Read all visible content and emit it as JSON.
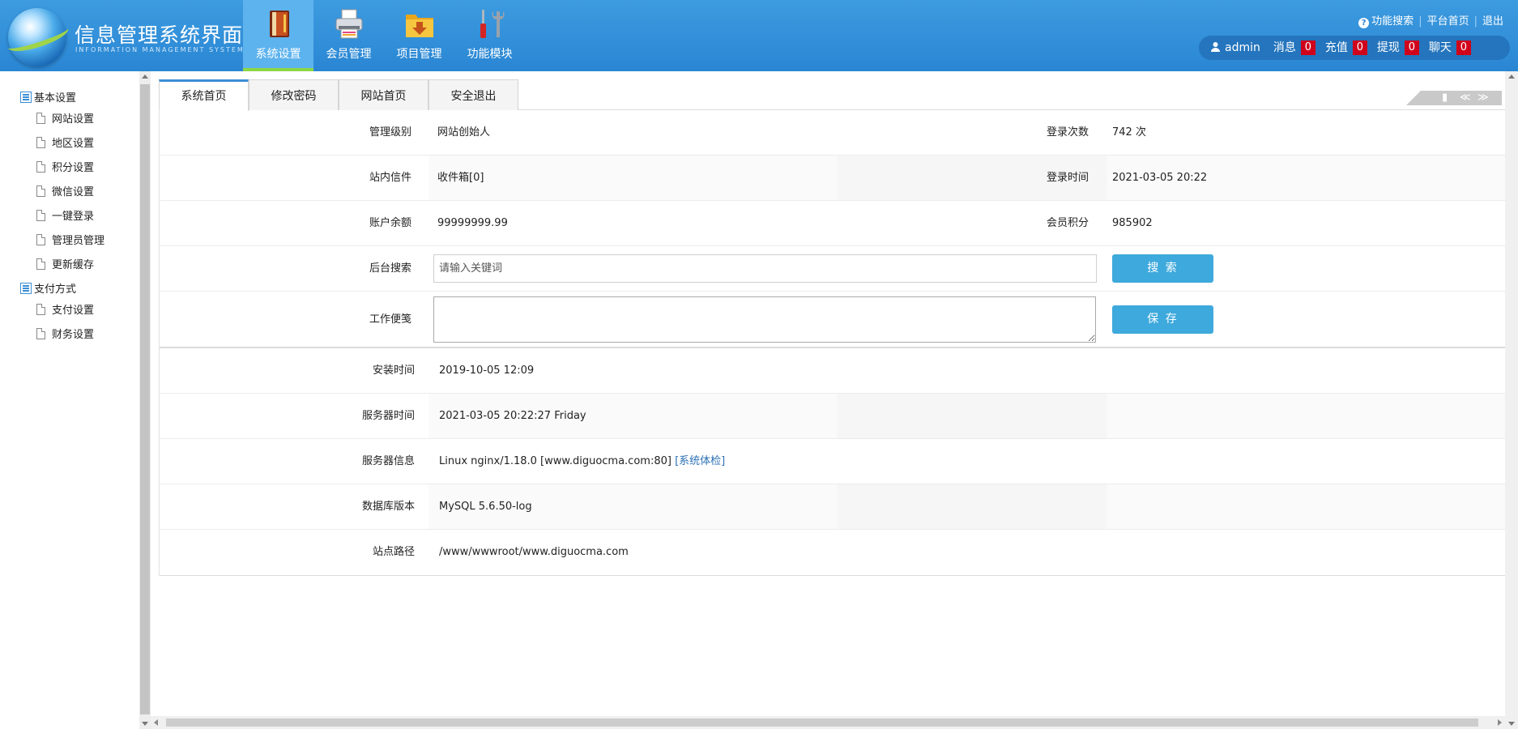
{
  "app": {
    "title": "信息管理系统界面",
    "subtitle": "INFORMATION MANAGEMENT SYSTEM GUI"
  },
  "nav": [
    {
      "label": "系统设置",
      "icon": "book-icon",
      "active": true
    },
    {
      "label": "会员管理",
      "icon": "printer-icon",
      "active": false
    },
    {
      "label": "项目管理",
      "icon": "folder-icon",
      "active": false
    },
    {
      "label": "功能模块",
      "icon": "tools-icon",
      "active": false
    }
  ],
  "top_links": {
    "search": "功能搜索",
    "home": "平台首页",
    "logout": "退出"
  },
  "user_bar": {
    "username": "admin",
    "items": [
      {
        "label": "消息",
        "count": "0"
      },
      {
        "label": "充值",
        "count": "0"
      },
      {
        "label": "提现",
        "count": "0"
      },
      {
        "label": "聊天",
        "count": "0"
      }
    ]
  },
  "sidebar": {
    "groups": [
      {
        "title": "基本设置",
        "items": [
          "网站设置",
          "地区设置",
          "积分设置",
          "微信设置",
          "一键登录",
          "管理员管理",
          "更新缓存"
        ]
      },
      {
        "title": "支付方式",
        "items": [
          "支付设置",
          "财务设置"
        ]
      }
    ]
  },
  "tabs": [
    "系统首页",
    "修改密码",
    "网站首页",
    "安全退出"
  ],
  "tab_tools": [
    "≪",
    "≫"
  ],
  "info": {
    "level_label": "管理级别",
    "level_value": "网站创始人",
    "login_count_label": "登录次数",
    "login_count_value": "742 次",
    "mail_label": "站内信件",
    "mail_value": "收件箱[0]",
    "login_time_label": "登录时间",
    "login_time_value": "2021-03-05 20:22",
    "balance_label": "账户余额",
    "balance_value": "99999999.99",
    "points_label": "会员积分",
    "points_value": "985902",
    "search_label": "后台搜索",
    "search_placeholder": "请输入关键词",
    "search_button": "搜 索",
    "memo_label": "工作便笺",
    "save_button": "保 存"
  },
  "server": {
    "install_label": "安装时间",
    "install_value": "2019-10-05 12:09",
    "server_time_label": "服务器时间",
    "server_time_value": "2021-03-05 20:22:27 Friday",
    "server_info_label": "服务器信息",
    "server_info_value": "Linux nginx/1.18.0 [www.diguocma.com:80]",
    "server_check_link": "[系统体检]",
    "db_label": "数据库版本",
    "db_value": "MySQL 5.6.50-log",
    "path_label": "站点路径",
    "path_value": "/www/wwwroot/www.diguocma.com"
  },
  "colors": {
    "header": "#2a86d3",
    "active_nav": "#5db3ee",
    "active_underline": "#8ed645",
    "badge": "#d0021b",
    "button": "#3ea9dc",
    "link": "#2a6fb4"
  }
}
